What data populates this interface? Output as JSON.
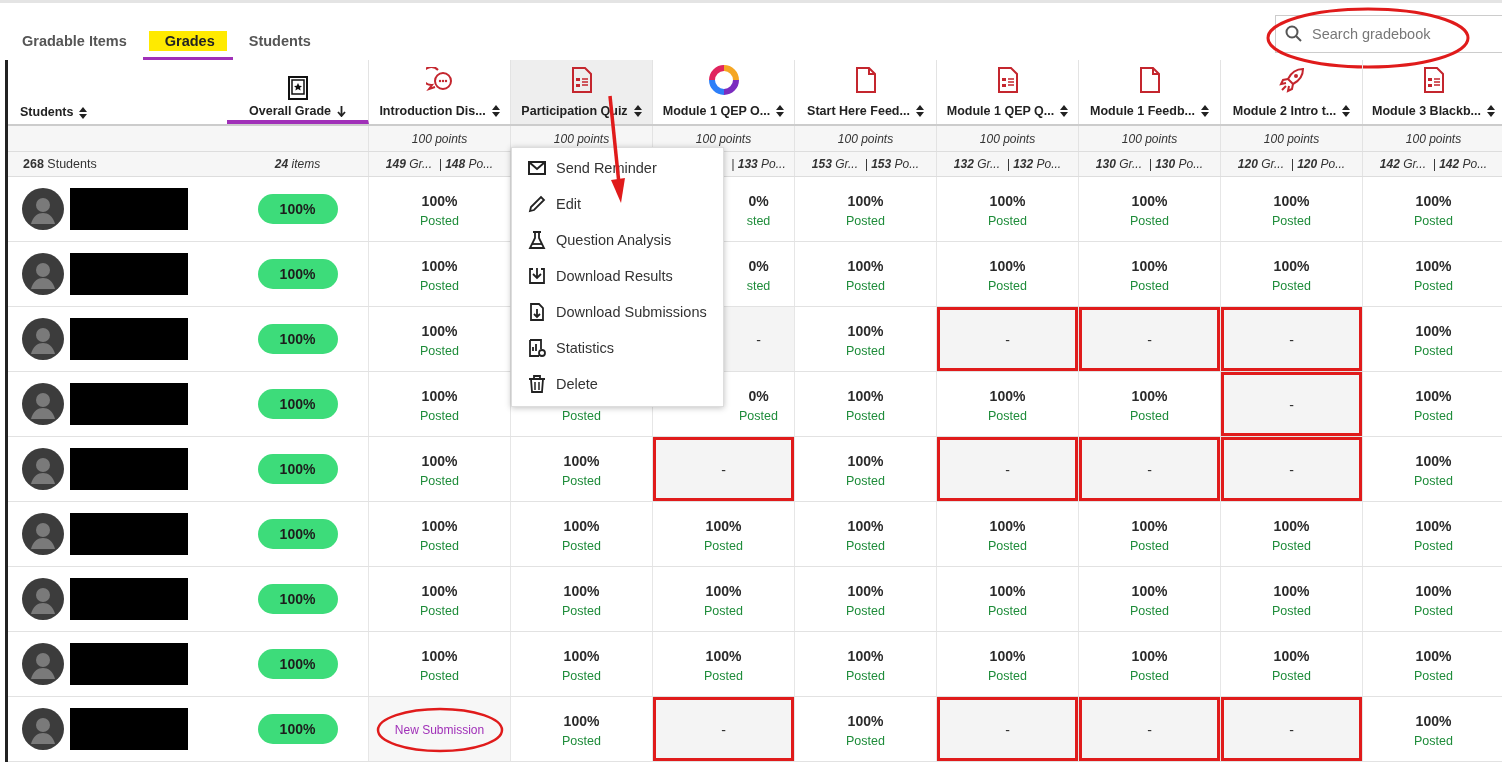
{
  "tabs": [
    {
      "label": "Gradable Items",
      "selected": false,
      "highlighted": false
    },
    {
      "label": "Grades",
      "selected": true,
      "highlighted": true
    },
    {
      "label": "Students",
      "selected": false,
      "highlighted": false
    }
  ],
  "search": {
    "placeholder": "Search gradebook",
    "circled": true
  },
  "students_header": {
    "label": "Students",
    "count": "**268** Students"
  },
  "overall_header": {
    "label": "Overall Grade",
    "stats": "**24** items",
    "sorted": true
  },
  "columns": [
    {
      "label": "Introduction Dis...",
      "kind": "discussion",
      "points": "100 points",
      "stats": "**149** Gr...  | **148** Po...",
      "selected": false
    },
    {
      "label": "Participation Quiz",
      "kind": "test",
      "points": "100 points",
      "selected": true
    },
    {
      "label": "Module 1 QEP O...",
      "kind": "logo",
      "points": "100 points",
      "stats": "| **133** Po...",
      "stats_covered": true,
      "selected": false
    },
    {
      "label": "Start Here Feed...",
      "kind": "document",
      "points": "100 points",
      "stats": "**153** Gr...  | **153** Po...",
      "selected": false
    },
    {
      "label": "Module 1 QEP Q...",
      "kind": "test",
      "points": "100 points",
      "stats": "**132** Gr...  | **132** Po...",
      "selected": false
    },
    {
      "label": "Module 1 Feedb...",
      "kind": "document",
      "points": "100 points",
      "stats": "**130** Gr...  | **130** Po...",
      "selected": false
    },
    {
      "label": "Module 2 Intro t...",
      "kind": "rocket",
      "points": "100 points",
      "stats": "**120** Gr...  | **120** Po...",
      "selected": false
    },
    {
      "label": "Module 3 Blackb...",
      "kind": "test",
      "points": "100 points",
      "stats": "**142** Gr...  | **142** Po...",
      "selected": false
    }
  ],
  "rows": [
    {
      "name_redacted": true,
      "overall": "100%",
      "cells": [
        {
          "kind": "graded",
          "grade": "100%",
          "status": "Posted",
          "highlighted": false
        },
        {
          "kind": "hidden"
        },
        {
          "kind": "graded",
          "grade": "0%",
          "status": "sted",
          "covered": true,
          "highlighted": false
        },
        {
          "kind": "graded",
          "grade": "100%",
          "status": "Posted",
          "highlighted": false
        },
        {
          "kind": "graded",
          "grade": "100%",
          "status": "Posted",
          "highlighted": false
        },
        {
          "kind": "graded",
          "grade": "100%",
          "status": "Posted",
          "highlighted": false
        },
        {
          "kind": "graded",
          "grade": "100%",
          "status": "Posted",
          "highlighted": false
        },
        {
          "kind": "graded",
          "grade": "100%",
          "status": "Posted",
          "highlighted": false
        }
      ]
    },
    {
      "name_redacted": true,
      "overall": "100%",
      "cells": [
        {
          "kind": "graded",
          "grade": "100%",
          "status": "Posted",
          "highlighted": false
        },
        {
          "kind": "hidden"
        },
        {
          "kind": "graded",
          "grade": "0%",
          "status": "sted",
          "covered": true,
          "highlighted": false
        },
        {
          "kind": "graded",
          "grade": "100%",
          "status": "Posted",
          "highlighted": false
        },
        {
          "kind": "graded",
          "grade": "100%",
          "status": "Posted",
          "highlighted": false
        },
        {
          "kind": "graded",
          "grade": "100%",
          "status": "Posted",
          "highlighted": false
        },
        {
          "kind": "graded",
          "grade": "100%",
          "status": "Posted",
          "highlighted": false
        },
        {
          "kind": "graded",
          "grade": "100%",
          "status": "Posted",
          "highlighted": false
        }
      ]
    },
    {
      "name_redacted": true,
      "overall": "100%",
      "cells": [
        {
          "kind": "graded",
          "grade": "100%",
          "status": "Posted",
          "highlighted": false
        },
        {
          "kind": "hidden"
        },
        {
          "kind": "none",
          "grade": "-",
          "covered": true,
          "highlighted": false
        },
        {
          "kind": "graded",
          "grade": "100%",
          "status": "Posted",
          "highlighted": false
        },
        {
          "kind": "none",
          "grade": "-",
          "highlighted": true
        },
        {
          "kind": "none",
          "grade": "-",
          "highlighted": true
        },
        {
          "kind": "none",
          "grade": "-",
          "highlighted": true
        },
        {
          "kind": "graded",
          "grade": "100%",
          "status": "Posted",
          "highlighted": false
        }
      ]
    },
    {
      "name_redacted": true,
      "overall": "100%",
      "cells": [
        {
          "kind": "graded",
          "grade": "100%",
          "status": "Posted",
          "highlighted": false
        },
        {
          "kind": "graded",
          "status": "Posted",
          "highlighted": false
        },
        {
          "kind": "graded",
          "grade": "0%",
          "status": "Posted",
          "covered": true,
          "highlighted": false
        },
        {
          "kind": "graded",
          "grade": "100%",
          "status": "Posted",
          "highlighted": false
        },
        {
          "kind": "graded",
          "grade": "100%",
          "status": "Posted",
          "highlighted": false
        },
        {
          "kind": "graded",
          "grade": "100%",
          "status": "Posted",
          "highlighted": false
        },
        {
          "kind": "none",
          "grade": "-",
          "highlighted": true
        },
        {
          "kind": "graded",
          "grade": "100%",
          "status": "Posted",
          "highlighted": false
        }
      ]
    },
    {
      "name_redacted": true,
      "overall": "100%",
      "cells": [
        {
          "kind": "graded",
          "grade": "100%",
          "status": "Posted",
          "highlighted": false
        },
        {
          "kind": "graded",
          "grade": "100%",
          "status": "Posted",
          "highlighted": false
        },
        {
          "kind": "none",
          "grade": "-",
          "highlighted": true
        },
        {
          "kind": "graded",
          "grade": "100%",
          "status": "Posted",
          "highlighted": false
        },
        {
          "kind": "none",
          "grade": "-",
          "highlighted": true
        },
        {
          "kind": "none",
          "grade": "-",
          "highlighted": true
        },
        {
          "kind": "none",
          "grade": "-",
          "highlighted": true
        },
        {
          "kind": "graded",
          "grade": "100%",
          "status": "Posted",
          "highlighted": false
        }
      ]
    },
    {
      "name_redacted": true,
      "overall": "100%",
      "cells": [
        {
          "kind": "graded",
          "grade": "100%",
          "status": "Posted",
          "highlighted": false
        },
        {
          "kind": "graded",
          "grade": "100%",
          "status": "Posted",
          "highlighted": false
        },
        {
          "kind": "graded",
          "grade": "100%",
          "status": "Posted",
          "highlighted": false
        },
        {
          "kind": "graded",
          "grade": "100%",
          "status": "Posted",
          "highlighted": false
        },
        {
          "kind": "graded",
          "grade": "100%",
          "status": "Posted",
          "highlighted": false
        },
        {
          "kind": "graded",
          "grade": "100%",
          "status": "Posted",
          "highlighted": false
        },
        {
          "kind": "graded",
          "grade": "100%",
          "status": "Posted",
          "highlighted": false
        },
        {
          "kind": "graded",
          "grade": "100%",
          "status": "Posted",
          "highlighted": false
        }
      ]
    },
    {
      "name_redacted": true,
      "overall": "100%",
      "cells": [
        {
          "kind": "graded",
          "grade": "100%",
          "status": "Posted",
          "highlighted": false
        },
        {
          "kind": "graded",
          "grade": "100%",
          "status": "Posted",
          "highlighted": false
        },
        {
          "kind": "graded",
          "grade": "100%",
          "status": "Posted",
          "highlighted": false
        },
        {
          "kind": "graded",
          "grade": "100%",
          "status": "Posted",
          "highlighted": false
        },
        {
          "kind": "graded",
          "grade": "100%",
          "status": "Posted",
          "highlighted": false
        },
        {
          "kind": "graded",
          "grade": "100%",
          "status": "Posted",
          "highlighted": false
        },
        {
          "kind": "graded",
          "grade": "100%",
          "status": "Posted",
          "highlighted": false
        },
        {
          "kind": "graded",
          "grade": "100%",
          "status": "Posted",
          "highlighted": false
        }
      ]
    },
    {
      "name_redacted": true,
      "overall": "100%",
      "cells": [
        {
          "kind": "graded",
          "grade": "100%",
          "status": "Posted",
          "highlighted": false
        },
        {
          "kind": "graded",
          "grade": "100%",
          "status": "Posted",
          "highlighted": false
        },
        {
          "kind": "graded",
          "grade": "100%",
          "status": "Posted",
          "highlighted": false
        },
        {
          "kind": "graded",
          "grade": "100%",
          "status": "Posted",
          "highlighted": false
        },
        {
          "kind": "graded",
          "grade": "100%",
          "status": "Posted",
          "highlighted": false
        },
        {
          "kind": "graded",
          "grade": "100%",
          "status": "Posted",
          "highlighted": false
        },
        {
          "kind": "graded",
          "grade": "100%",
          "status": "Posted",
          "highlighted": false
        },
        {
          "kind": "graded",
          "grade": "100%",
          "status": "Posted",
          "highlighted": false
        }
      ]
    },
    {
      "name_redacted": true,
      "overall": "100%",
      "cells": [
        {
          "kind": "submission",
          "label": "New Submission",
          "circled": true
        },
        {
          "kind": "graded",
          "grade": "100%",
          "status": "Posted",
          "highlighted": false
        },
        {
          "kind": "none",
          "grade": "-",
          "highlighted": true
        },
        {
          "kind": "graded",
          "grade": "100%",
          "status": "Posted",
          "highlighted": false
        },
        {
          "kind": "none",
          "grade": "-",
          "highlighted": true
        },
        {
          "kind": "none",
          "grade": "-",
          "highlighted": true
        },
        {
          "kind": "none",
          "grade": "-",
          "highlighted": true
        },
        {
          "kind": "graded",
          "grade": "100%",
          "status": "Posted",
          "highlighted": false
        }
      ]
    }
  ],
  "menu": {
    "arrow": true,
    "items": [
      {
        "label": "Send Reminder",
        "kind": "envelope"
      },
      {
        "label": "Edit",
        "kind": "pencil"
      },
      {
        "label": "Question Analysis",
        "kind": "flask"
      },
      {
        "label": "Download Results",
        "kind": "download"
      },
      {
        "label": "Download Submissions",
        "kind": "download-file"
      },
      {
        "label": "Statistics",
        "kind": "statistics"
      },
      {
        "label": "Delete",
        "kind": "trash"
      }
    ]
  }
}
